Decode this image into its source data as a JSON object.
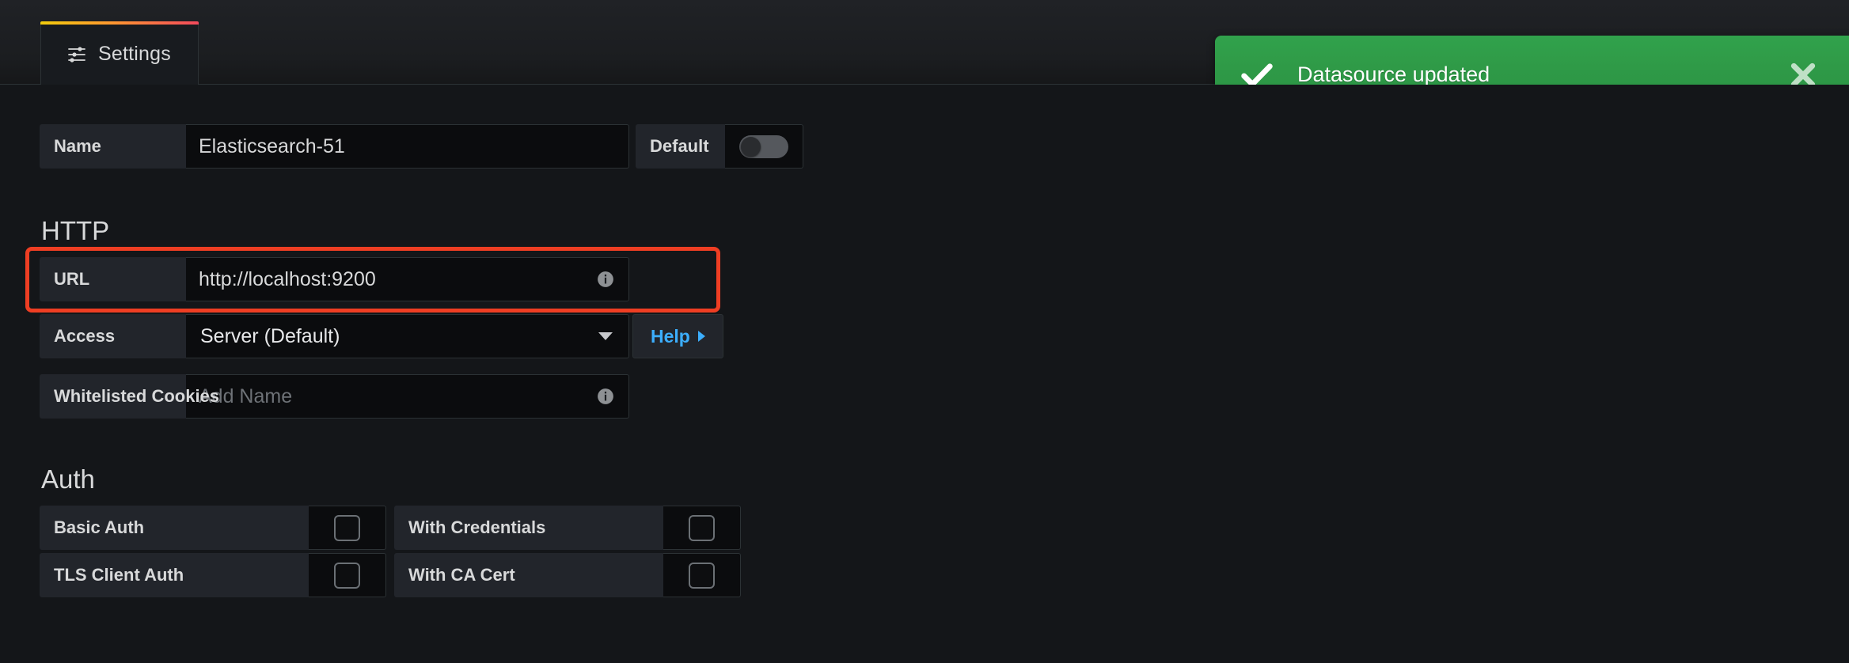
{
  "tabs": [
    {
      "label": "Settings",
      "icon": "sliders-icon",
      "active": true
    }
  ],
  "toast": {
    "message": "Datasource updated",
    "icon": "check-icon",
    "close_icon": "close-icon",
    "background_color": "#2f9a47"
  },
  "form": {
    "name_field": {
      "label": "Name",
      "value": "Elasticsearch-51",
      "info_icon": "info-icon"
    },
    "default_field": {
      "label": "Default",
      "toggle_state": "off"
    },
    "http_section": {
      "title": "HTTP",
      "url_field": {
        "label": "URL",
        "value": "http://localhost:9200",
        "info_icon": "info-icon",
        "highlight_color": "#ef3e23"
      },
      "access_field": {
        "label": "Access",
        "value": "Server (Default)",
        "caret_icon": "chevron-down-icon"
      },
      "help_button": {
        "label": "Help",
        "caret_icon": "chevron-right-icon",
        "color": "#3caefc"
      },
      "cookies_field": {
        "label": "Whitelisted Cookies",
        "value": "",
        "placeholder": "Add Name",
        "info_icon": "info-icon"
      }
    },
    "auth_section": {
      "title": "Auth",
      "rows": [
        {
          "left": {
            "label": "Basic Auth",
            "checked": false,
            "has_info": false
          },
          "right": {
            "label": "With Credentials",
            "checked": false,
            "has_info": true
          }
        },
        {
          "left": {
            "label": "TLS Client Auth",
            "checked": false,
            "has_info": false
          },
          "right": {
            "label": "With CA Cert",
            "checked": false,
            "has_info": true
          }
        }
      ]
    }
  }
}
